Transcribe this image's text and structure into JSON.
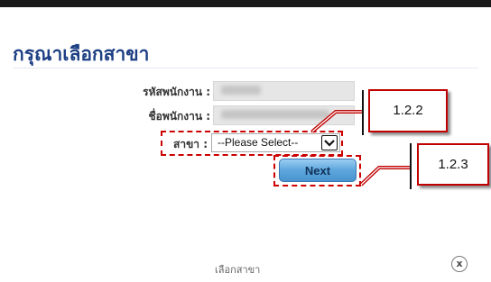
{
  "dialog": {
    "title": "กรุณาเลือกสาขา",
    "footer_title": "เลือกสาขา",
    "close_glyph": "x"
  },
  "form": {
    "employee_id_label": "รหัสพนักงาน :",
    "employee_name_label": "ชื่อพนักงาน :",
    "branch_label": "สาขา :",
    "branch_value": "--Please Select--",
    "next_label": "Next"
  },
  "annotations": {
    "callout_branch": "1.2.2",
    "callout_next": "1.2.3",
    "highlight_color": "#cc0000"
  },
  "icons": {
    "dropdown": "chevron-down-icon",
    "close": "close-icon"
  }
}
